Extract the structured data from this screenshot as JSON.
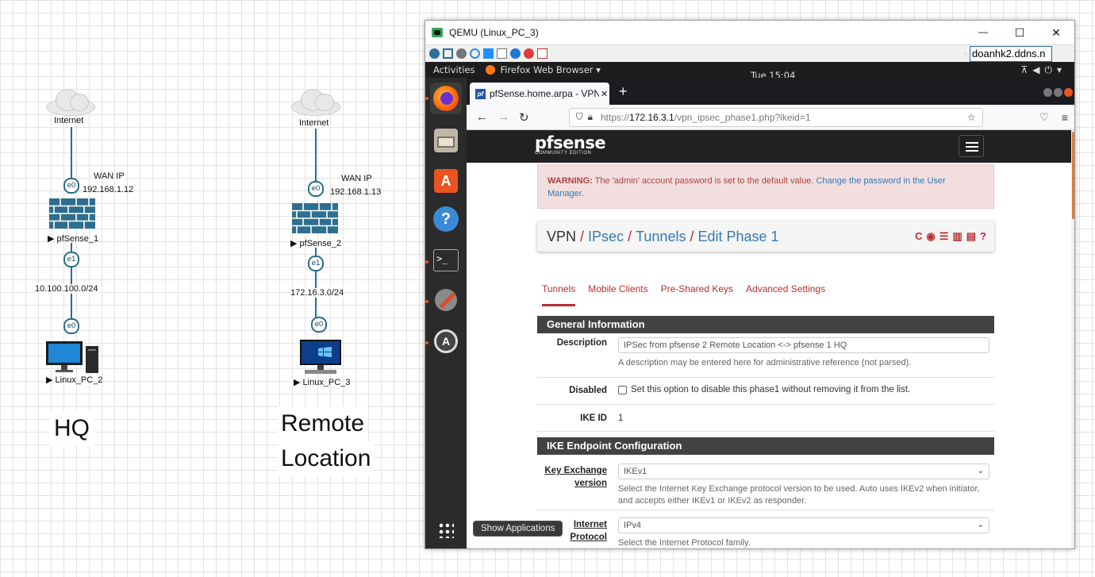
{
  "topology": {
    "hq": {
      "cloud_label": "Internet",
      "wan_label": "WAN IP",
      "wan_ip": "192.168.1.12",
      "if_e0_top": "e0",
      "router_label": "pfSense_1",
      "if_e1": "e1",
      "subnet": "10.100.100.0/24",
      "if_e0_bottom": "e0",
      "pc_label": "Linux_PC_2",
      "site_label": "HQ"
    },
    "remote": {
      "cloud_label": "Internet",
      "wan_label": "WAN IP",
      "wan_ip": "192.168.1.13",
      "if_e0_top": "e0",
      "router_label": "pfSense_2",
      "if_e1": "e1",
      "subnet": "172.16.3.0/24",
      "if_e0_bottom": "e0",
      "pc_label": "Linux_PC_3",
      "site_label_line1": "Remote",
      "site_label_line2": "Location"
    },
    "wire_color": "#2a6d8a"
  },
  "qemu": {
    "title": "QEMU (Linux_PC_3)",
    "host_field": "doanhk2.ddns.n",
    "window_controls": {
      "minimize": "—",
      "maximize": "☐",
      "close": "✕"
    }
  },
  "gnome": {
    "activities": "Activities",
    "app_menu": "Firefox Web Browser ▾",
    "clock": "Tue 15:04",
    "show_apps_tooltip": "Show Applications"
  },
  "browser": {
    "tab_title": "pfSense.home.arpa - VPN",
    "new_tab": "+",
    "url_prefix": "https://",
    "url_host": "172.16.3.1",
    "url_path": "/vpn_ipsec_phase1.php?ikeid=1"
  },
  "pfsense": {
    "logo_main": "pfsense",
    "logo_sub": "COMMUNITY EDITION",
    "warning_bold": "WARNING:",
    "warning_text": " The 'admin' account password is set to the default value. ",
    "warning_link": "Change the password in the User Manager.",
    "breadcrumb": {
      "vpn": "VPN",
      "ipsec": "IPsec",
      "tunnels": "Tunnels",
      "edit": "Edit Phase 1",
      "sep": "/"
    },
    "tabs": [
      "Tunnels",
      "Mobile Clients",
      "Pre-Shared Keys",
      "Advanced Settings"
    ],
    "active_tab": 0,
    "general_section": "General Information",
    "description_label": "Description",
    "description_value": "IPSec from pfsense 2 Remote Location <-> pfsense 1 HQ",
    "description_help": "A description may be entered here for administrative reference (not parsed).",
    "disabled_label": "Disabled",
    "disabled_help": "Set this option to disable this phase1 without removing it from the list.",
    "ikeid_label": "IKE ID",
    "ikeid_value": "1",
    "ike_section": "IKE Endpoint Configuration",
    "kex_label_1": "Key Exchange",
    "kex_label_2": "version",
    "kex_value": "IKEv1",
    "kex_help": "Select the Internet Key Exchange protocol version to be used. Auto uses IKEv2 when initiator, and accepts either IKEv1 or IKEv2 as responder.",
    "proto_label_1": "Internet",
    "proto_label_2": "Protocol",
    "proto_value": "IPv4",
    "proto_help": "Select the Internet Protocol family."
  },
  "colors": {
    "pfsense_red": "#b92e2e",
    "link_blue": "#3379b7",
    "ubuntu_orange": "#e95420",
    "dock_bg": "#2b2b2b"
  }
}
